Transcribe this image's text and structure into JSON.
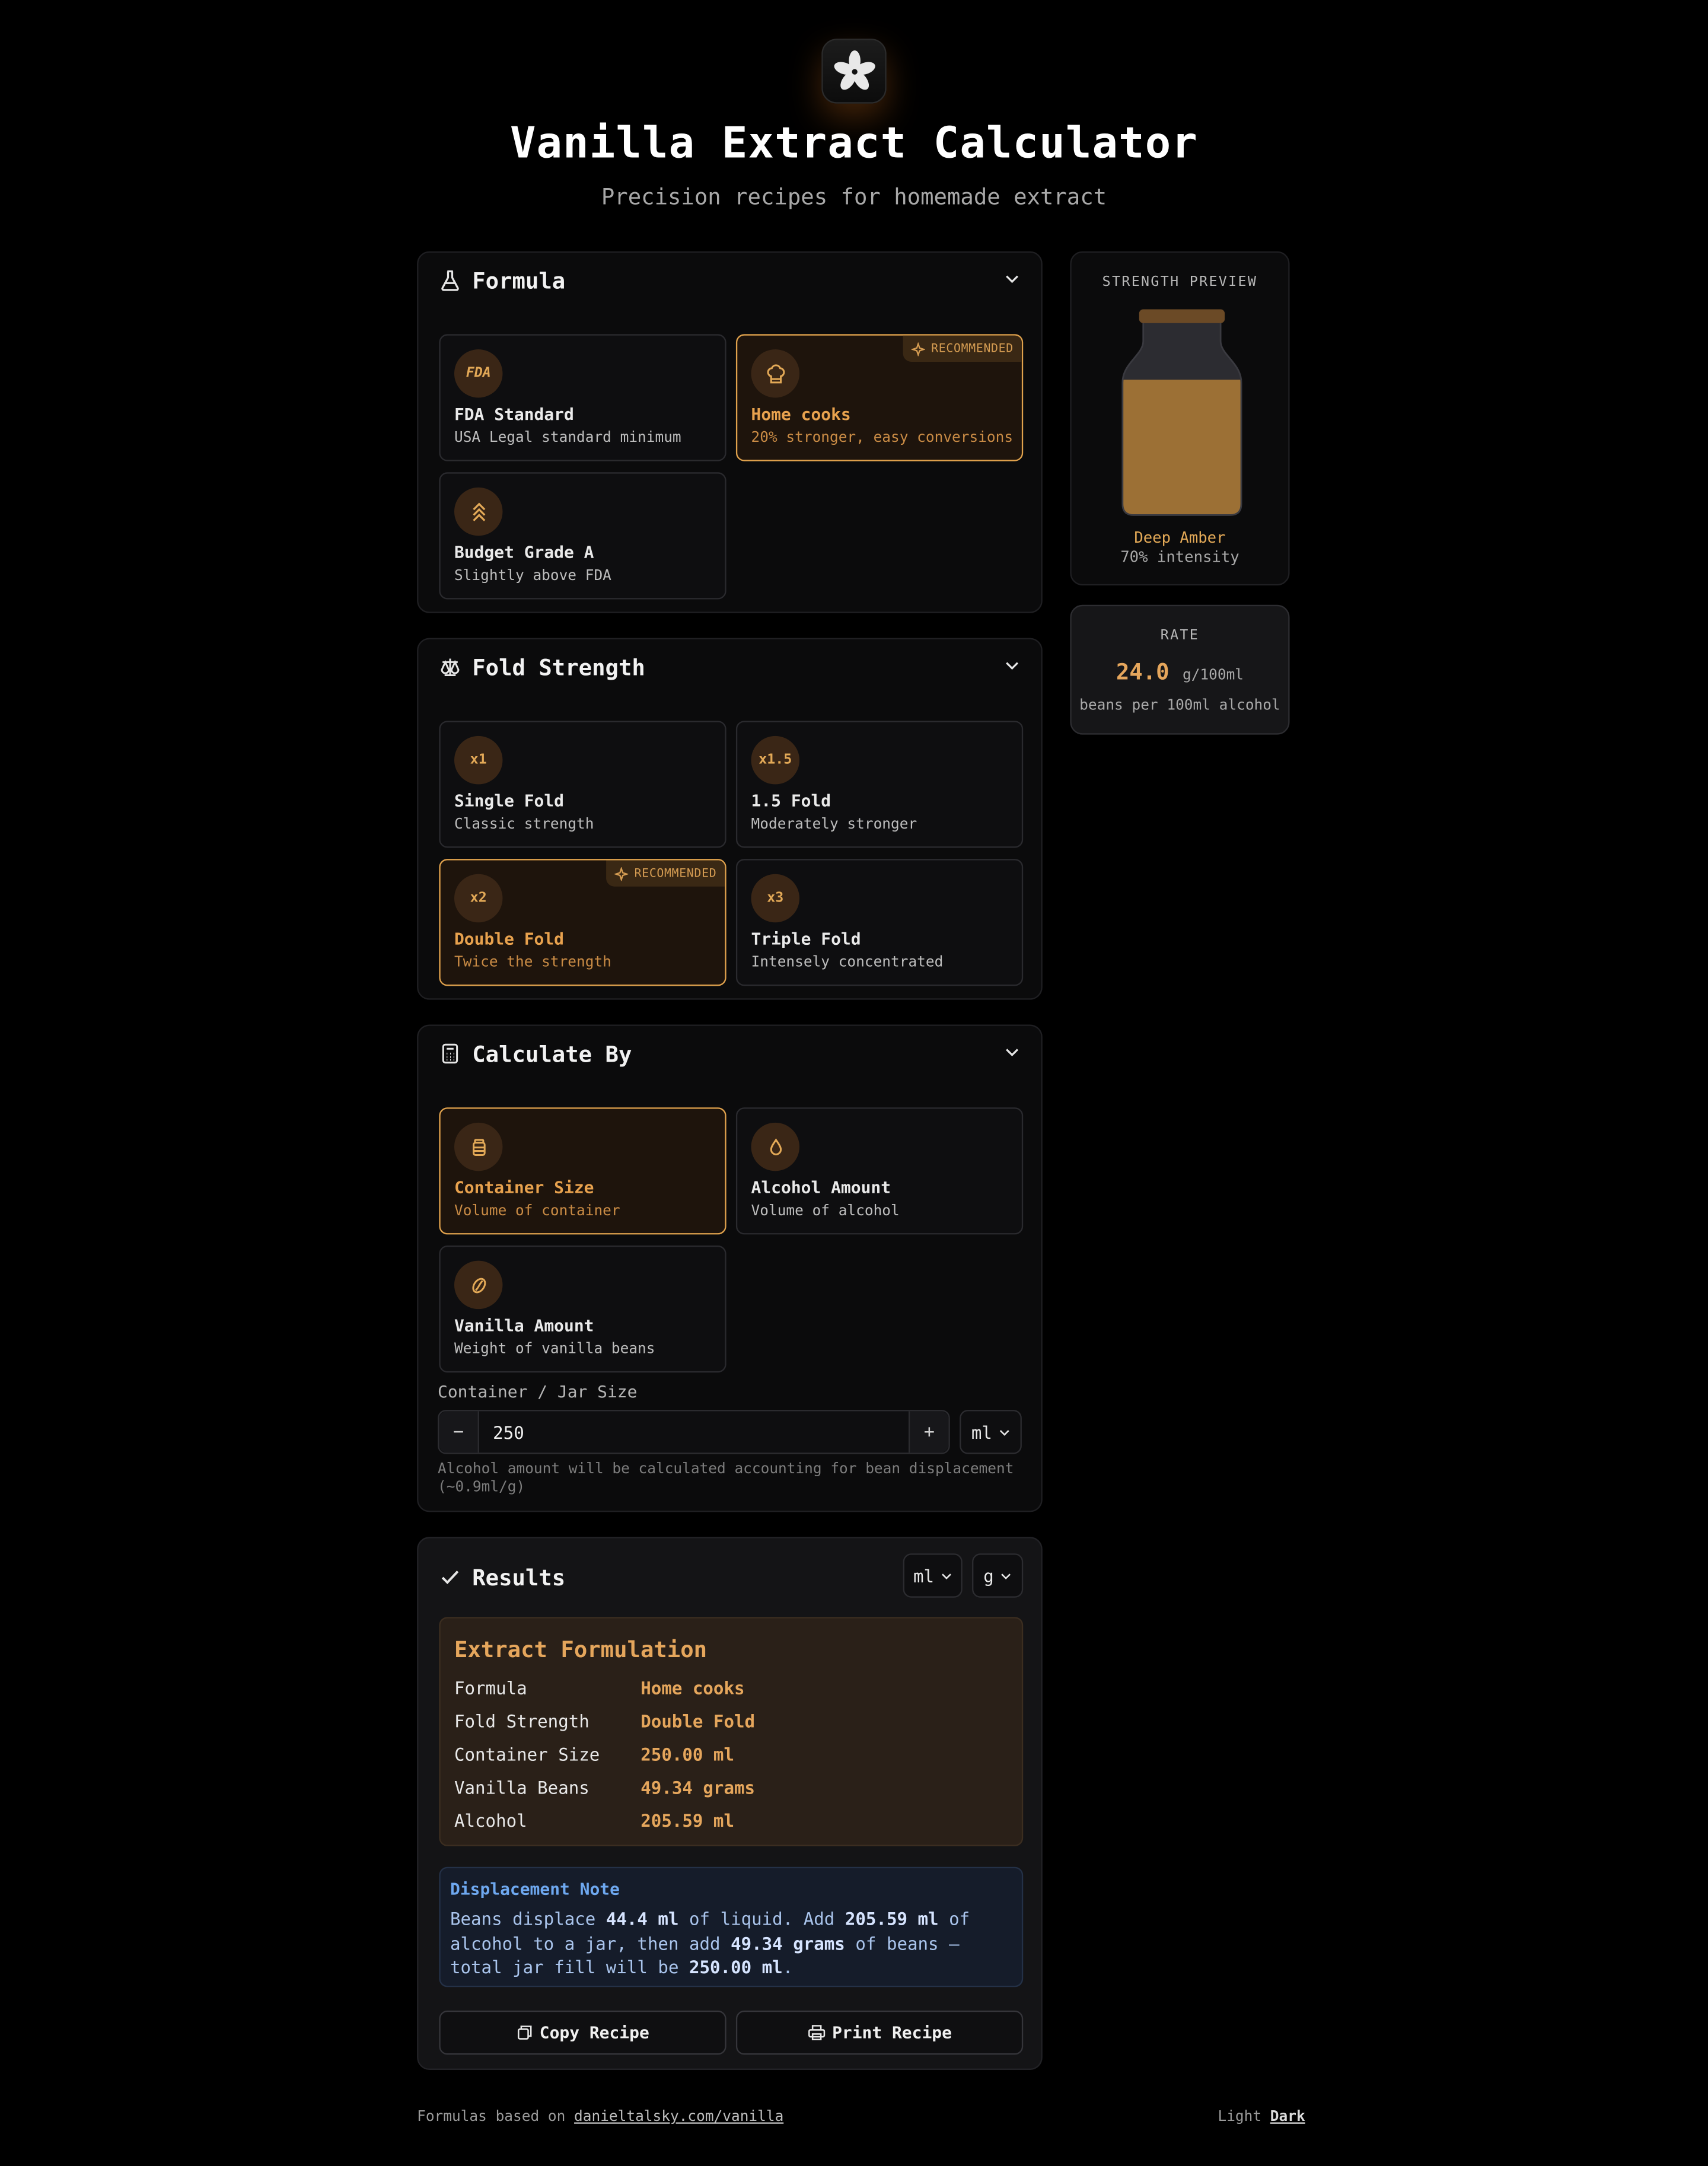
{
  "header": {
    "title": "Vanilla Extract Calculator",
    "subtitle": "Precision recipes for homemade extract",
    "logo_icon": "vanilla-flower-icon"
  },
  "colors": {
    "accent": "#e5a65c",
    "background": "#000000",
    "card": "#0b0b0c",
    "note_blue": "#6ea8f0"
  },
  "formula": {
    "title": "Formula",
    "options": [
      {
        "icon": "fda-icon",
        "icon_text": "FDA",
        "title": "FDA Standard",
        "desc": "USA Legal standard minimum",
        "selected": false
      },
      {
        "icon": "chef-hat-icon",
        "title": "Home cooks",
        "desc": "20% stronger, easy conversions",
        "selected": true,
        "badge": "RECOMMENDED"
      },
      {
        "icon": "chevrons-up-icon",
        "title": "Budget Grade A",
        "desc": "Slightly above FDA",
        "selected": false
      }
    ]
  },
  "fold": {
    "title": "Fold Strength",
    "options": [
      {
        "icon_text": "x1",
        "title": "Single Fold",
        "desc": "Classic strength",
        "selected": false
      },
      {
        "icon_text": "x1.5",
        "title": "1.5 Fold",
        "desc": "Moderately stronger",
        "selected": false
      },
      {
        "icon_text": "x2",
        "title": "Double Fold",
        "desc": "Twice the strength",
        "selected": true,
        "badge": "RECOMMENDED"
      },
      {
        "icon_text": "x3",
        "title": "Triple Fold",
        "desc": "Intensely concentrated",
        "selected": false
      }
    ]
  },
  "calc": {
    "title": "Calculate By",
    "options": [
      {
        "icon": "jar-icon",
        "title": "Container Size",
        "desc": "Volume of container",
        "selected": true
      },
      {
        "icon": "droplet-icon",
        "title": "Alcohol Amount",
        "desc": "Volume of alcohol",
        "selected": false
      },
      {
        "icon": "bean-icon",
        "title": "Vanilla Amount",
        "desc": "Weight of vanilla beans",
        "selected": false
      }
    ],
    "input_label": "Container / Jar Size",
    "minus": "−",
    "plus": "+",
    "value": "250",
    "unit": "ml",
    "hint": "Alcohol amount will be calculated accounting for bean displacement (~0.9ml/g)"
  },
  "results": {
    "title": "Results",
    "volume_unit": "ml",
    "weight_unit": "g",
    "box_title": "Extract Formulation",
    "rows": [
      {
        "k": "Formula",
        "v": "Home cooks"
      },
      {
        "k": "Fold Strength",
        "v": "Double Fold"
      },
      {
        "k": "Container Size",
        "v": "250.00 ml"
      },
      {
        "k": "Vanilla Beans",
        "v": "49.34 grams"
      },
      {
        "k": "Alcohol",
        "v": "205.59 ml"
      }
    ],
    "note": {
      "title": "Displacement Note",
      "t1": "Beans displace ",
      "b1": "44.4 ml",
      "t2": " of liquid. Add ",
      "b2": "205.59 ml",
      "t3": " of alcohol to a jar, then add ",
      "b3": "49.34 grams",
      "t4": " of beans — total jar fill will be ",
      "b4": "250.00 ml",
      "t5": "."
    },
    "copy_label": "Copy Recipe",
    "print_label": "Print Recipe"
  },
  "preview": {
    "title": "STRENGTH PREVIEW",
    "color_name": "Deep Amber",
    "intensity": "70% intensity",
    "fill_fraction": 0.7,
    "liquid_color": "#9c7035"
  },
  "rate": {
    "title": "RATE",
    "value": "24.0",
    "unit": "g/100ml",
    "desc": "beans per 100ml alcohol"
  },
  "footer": {
    "prefix": "Formulas based on ",
    "link": "danieltalsky.com/vanilla",
    "theme_light": "Light",
    "theme_dark": "Dark"
  }
}
